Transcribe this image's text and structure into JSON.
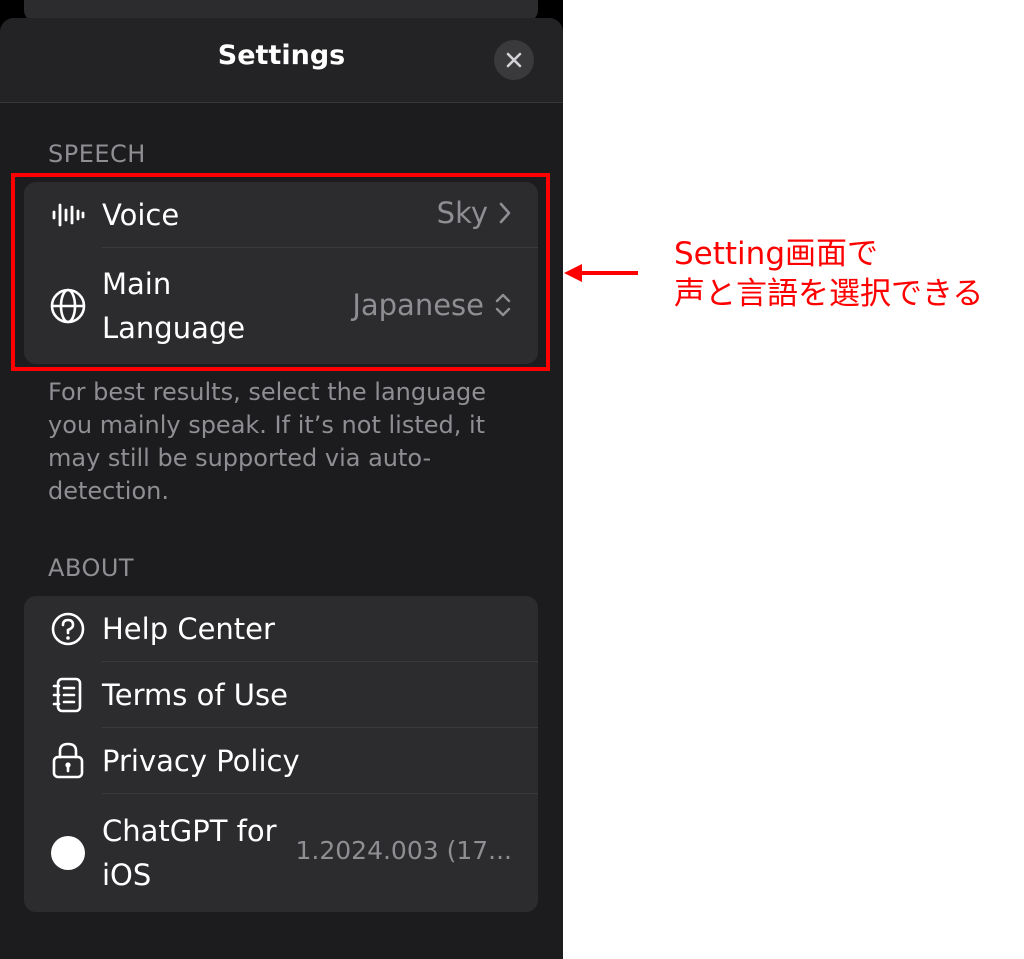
{
  "nav": {
    "title": "Settings",
    "close_icon": "close-icon"
  },
  "speech": {
    "header": "SPEECH",
    "voice": {
      "label": "Voice",
      "value": "Sky",
      "icon": "waveform-icon",
      "accessory": "chevron-right-icon"
    },
    "main_language": {
      "label_line1": "Main",
      "label_line2": "Language",
      "value": "Japanese",
      "icon": "globe-icon",
      "accessory": "chevron-up-down-icon"
    },
    "footnote": "For best results, select the language you mainly speak. If it’s not listed, it may still be supported via auto-detection."
  },
  "about": {
    "header": "ABOUT",
    "items": [
      {
        "label": "Help Center",
        "icon": "question-circle-icon"
      },
      {
        "label": "Terms of Use",
        "icon": "document-icon"
      },
      {
        "label": "Privacy Policy",
        "icon": "lock-icon"
      }
    ],
    "app": {
      "label_line1": "ChatGPT for",
      "label_line2": "iOS",
      "version": "1.2024.003 (17...",
      "icon": "chatgpt-logo-icon"
    }
  },
  "annotation": {
    "line1": "Setting画面で",
    "line2": "声と言語を選択できる"
  },
  "colors": {
    "accent": "#ff0000",
    "sheet": "#1c1c1e",
    "group": "#2c2c2e",
    "secondary_text": "#8e8e93"
  }
}
